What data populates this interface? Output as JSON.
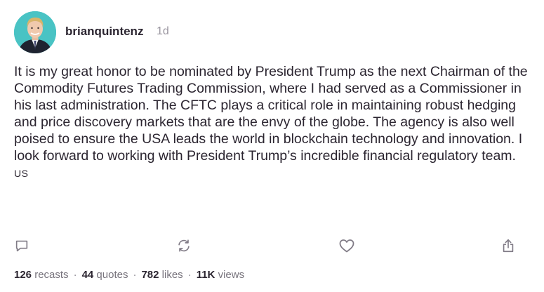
{
  "post": {
    "author": {
      "handle": "brianquintenz",
      "time_ago": "1d"
    },
    "text": "It is my great honor to be nominated by President Trump as the next Chairman of the Commodity Futures Trading Commission, where I had served as a Commissioner in his last administration. The CFTC plays a critical role in maintaining robust hedging and price discovery markets that are the envy of the globe. The agency is also well poised to ensure the USA leads the world in blockchain technology and innovation. I look forward to working with President Trump’s incredible financial regulatory team.",
    "flag": "US",
    "stats": {
      "recasts_count": "126",
      "recasts_label": "recasts",
      "quotes_count": "44",
      "quotes_label": "quotes",
      "likes_count": "782",
      "likes_label": "likes",
      "views_count": "11K",
      "views_label": "views",
      "separator": "·"
    },
    "actions": [
      {
        "name": "reply",
        "icon": "comment-icon"
      },
      {
        "name": "recast",
        "icon": "recast-icon"
      },
      {
        "name": "like",
        "icon": "heart-icon"
      },
      {
        "name": "share",
        "icon": "share-icon"
      }
    ]
  },
  "colors": {
    "avatar_bg": "#49c3c4",
    "text": "#2b2530",
    "muted": "#77737c",
    "icon": "#807b86"
  }
}
